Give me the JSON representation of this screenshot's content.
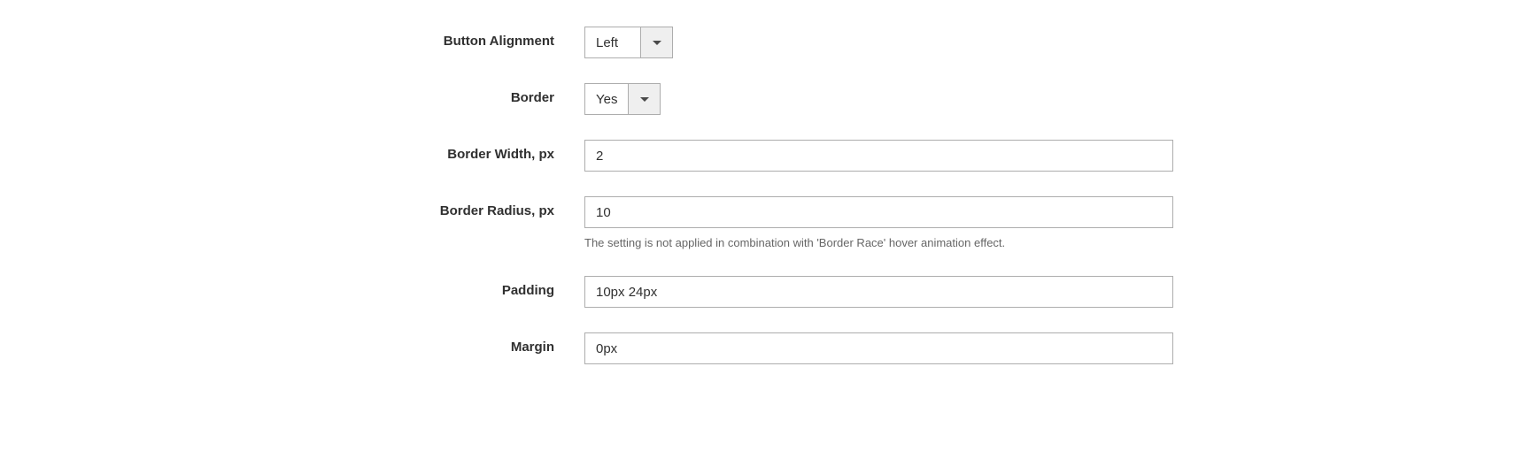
{
  "fields": {
    "button_alignment": {
      "label": "Button Alignment",
      "value": "Left"
    },
    "border": {
      "label": "Border",
      "value": "Yes"
    },
    "border_width": {
      "label": "Border Width, px",
      "value": "2"
    },
    "border_radius": {
      "label": "Border Radius, px",
      "value": "10",
      "helper": "The setting is not applied in combination with 'Border Race' hover animation effect."
    },
    "padding": {
      "label": "Padding",
      "value": "10px 24px"
    },
    "margin": {
      "label": "Margin",
      "value": "0px"
    }
  }
}
